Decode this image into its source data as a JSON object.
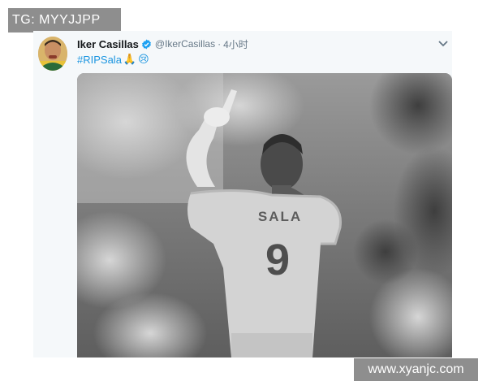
{
  "watermarks": {
    "top_left": "TG: MYYJJPP",
    "bottom_right": "www.xyanjc.com"
  },
  "tweet": {
    "author": {
      "display_name": "Iker Casillas",
      "handle": "@IkerCasillas",
      "verified": true,
      "avatar_icon": "profile-photo"
    },
    "separator": "·",
    "timestamp": "4小时",
    "text": {
      "hashtag": "#RIPSala",
      "emojis": [
        "🙏",
        "😢"
      ]
    },
    "photo": {
      "jersey_name": "SALA",
      "jersey_number": "9",
      "tone": "grayscale"
    },
    "menu_icon": "chevron-down-icon"
  },
  "colors": {
    "link_blue": "#1b95e0",
    "verified_blue": "#1da1f2",
    "card_background": "#f5f8fa",
    "watermark_gray": "#8e8e8e"
  }
}
